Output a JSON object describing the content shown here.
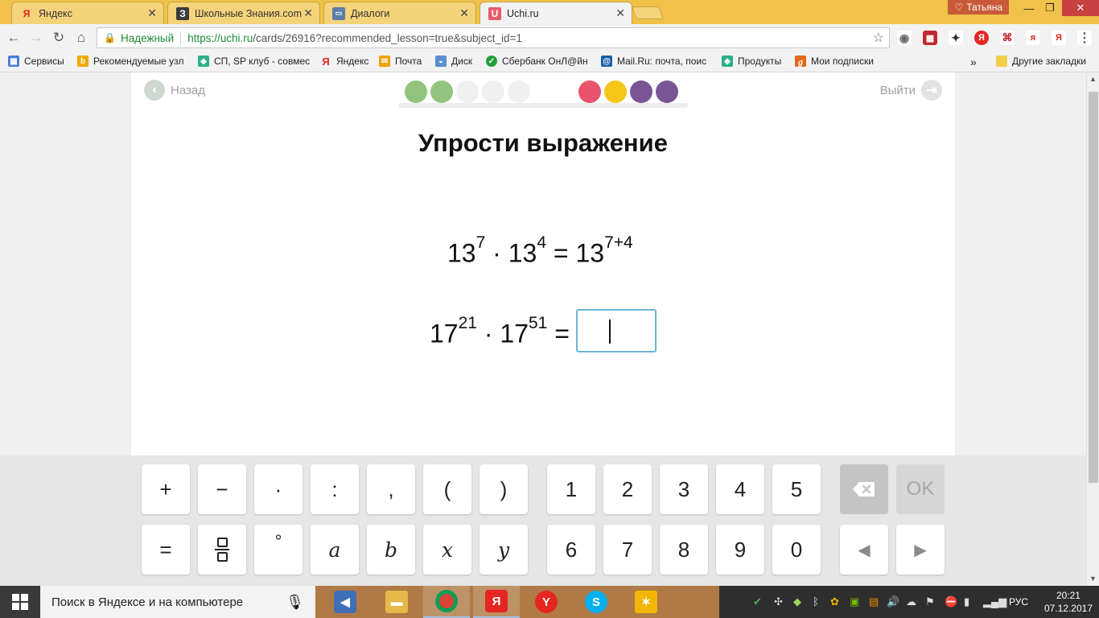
{
  "browser": {
    "tabs": [
      {
        "title": "Яндекс",
        "favicon": "Я",
        "fav_color": "#e52620",
        "active": false
      },
      {
        "title": "Школьные Знания.com",
        "favicon": "З",
        "fav_color": "#3b3b3b",
        "active": false
      },
      {
        "title": "Диалоги",
        "favicon": "💬",
        "fav_color": "#5a7fa8",
        "active": false
      },
      {
        "title": "Uchi.ru",
        "favicon": "U",
        "fav_color": "#e85a6a",
        "active": true
      }
    ],
    "user": "Татьяна",
    "security_label": "Надежный",
    "url_host": "https://uchi.ru",
    "url_path": "/cards/26916?recommended_lesson=true&subject_id=1",
    "bookmarks": [
      {
        "label": "Сервисы",
        "icon": "apps-icon",
        "color": "#4a7de0"
      },
      {
        "label": "Рекомендуемые узл",
        "icon": "bing-icon",
        "color": "#f0a800"
      },
      {
        "label": "СП, SP клуб - совмес",
        "icon": "diamond-icon",
        "color": "#2ab08a"
      },
      {
        "label": "Яндекс",
        "icon": "yandex-icon",
        "color": "#e52620"
      },
      {
        "label": "Почта",
        "icon": "mail-icon",
        "color": "#f0a000"
      },
      {
        "label": "Диск",
        "icon": "disk-icon",
        "color": "#5a8fd0"
      },
      {
        "label": "Сбербанк ОнЛ@йн",
        "icon": "sber-icon",
        "color": "#21a038"
      },
      {
        "label": "Mail.Ru: почта, поис",
        "icon": "mailru-icon",
        "color": "#1b5fa8"
      },
      {
        "label": "Продукты",
        "icon": "diamond-icon",
        "color": "#2ab08a"
      },
      {
        "label": "Мои подписки",
        "icon": "rss-icon",
        "color": "#e06a1a"
      }
    ],
    "more_bookmarks": "»",
    "other_bookmarks": "Другие закладки"
  },
  "lesson": {
    "back_label": "Назад",
    "exit_label": "Выйти",
    "title": "Упрости выражение",
    "progress_dots": [
      "#93c47d",
      "#93c47d",
      "#f0f0f0",
      "#f0f0f0",
      "#f0f0f0",
      "#e8536a",
      "#f5c518",
      "#7a5596",
      "#7a5596"
    ],
    "example": {
      "base1": "13",
      "exp1": "7",
      "dot": "·",
      "base2": "13",
      "exp2": "4",
      "eq": "=",
      "base3": "13",
      "exp3": "7+4"
    },
    "task": {
      "base1": "17",
      "exp1": "21",
      "dot": "·",
      "base2": "17",
      "exp2": "51",
      "eq": "="
    },
    "answer_value": ""
  },
  "keyboard": {
    "row1_symbols": [
      "+",
      "−",
      "·",
      ":",
      ",",
      "(",
      ")"
    ],
    "row1_digits": [
      "1",
      "2",
      "3",
      "4",
      "5"
    ],
    "row2_symbols": [
      "=",
      "fraction",
      "°",
      "a",
      "b",
      "x",
      "y"
    ],
    "row2_digits": [
      "6",
      "7",
      "8",
      "9",
      "0"
    ],
    "backspace_icon": "backspace-icon",
    "ok_label": "OK",
    "left_arrow": "◀",
    "right_arrow": "▶"
  },
  "taskbar": {
    "search_placeholder": "Поиск в Яндексе и на компьютере",
    "language": "РУС",
    "time": "20:21",
    "date": "07.12.2017"
  }
}
